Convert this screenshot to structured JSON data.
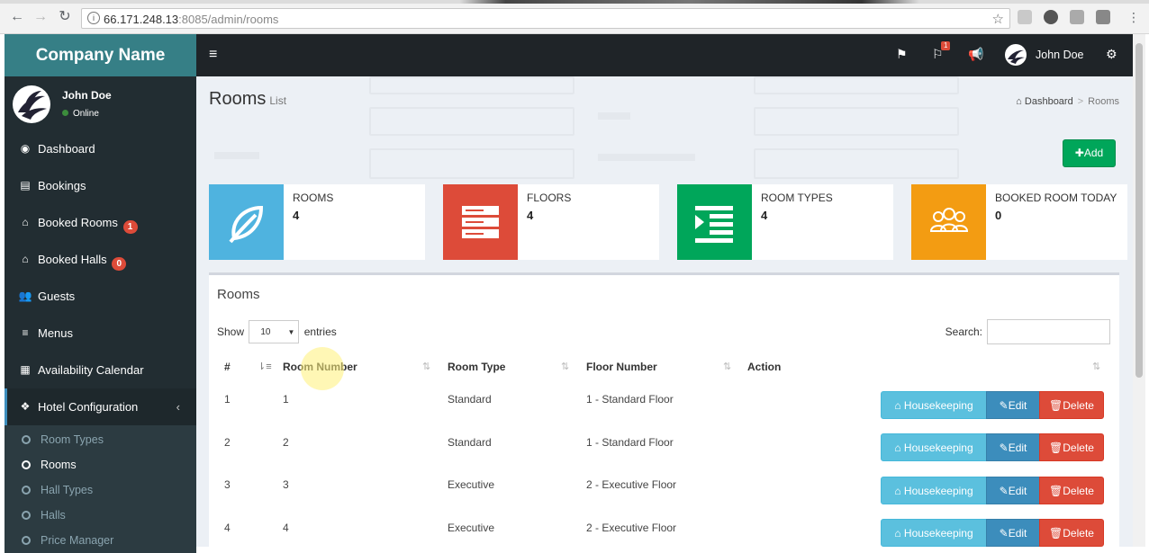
{
  "browser": {
    "url_host": "66.171.248.13",
    "url_rest": ":8085/admin/rooms"
  },
  "sidebar": {
    "brand": "Company Name",
    "user": {
      "name": "John Doe",
      "status": "Online"
    },
    "items": [
      {
        "label": "Dashboard",
        "icon": "dashboard-icon"
      },
      {
        "label": "Bookings",
        "icon": "list-icon"
      },
      {
        "label": "Booked Rooms",
        "icon": "home-icon",
        "badge": "1"
      },
      {
        "label": "Booked Halls",
        "icon": "home-icon",
        "badge": "0"
      },
      {
        "label": "Guests",
        "icon": "users-icon"
      },
      {
        "label": "Menus",
        "icon": "bars-icon"
      },
      {
        "label": "Availability Calendar",
        "icon": "calendar-icon"
      },
      {
        "label": "Hotel Configuration",
        "icon": "cubes-icon"
      }
    ],
    "submenu": [
      {
        "label": "Room Types"
      },
      {
        "label": "Rooms"
      },
      {
        "label": "Hall Types"
      },
      {
        "label": "Halls"
      },
      {
        "label": "Price Manager"
      }
    ]
  },
  "topnav": {
    "flag_badge": "1",
    "user_name": "John Doe"
  },
  "page": {
    "title": "Rooms",
    "subtitle": "List",
    "breadcrumb": [
      "Dashboard",
      "Rooms"
    ],
    "add_label": "Add"
  },
  "stats": [
    {
      "label": "ROOMS",
      "value": "4",
      "color": "#4fb3df",
      "icon": "leaf-icon"
    },
    {
      "label": "FLOORS",
      "value": "4",
      "color": "#dd4b39",
      "icon": "server-icon"
    },
    {
      "label": "ROOM TYPES",
      "value": "4",
      "color": "#00a65a",
      "icon": "indent-icon"
    },
    {
      "label": "BOOKED ROOM TODAY",
      "value": "0",
      "color": "#f39c12",
      "icon": "group-icon"
    }
  ],
  "table": {
    "title": "Rooms",
    "show_label": "Show",
    "length_value": "10",
    "entries_label": "entries",
    "search_label": "Search:",
    "columns": [
      "#",
      "Room Number",
      "Room Type",
      "Floor Number",
      "Action"
    ],
    "rows": [
      {
        "idx": "1",
        "number": "1",
        "type": "Standard",
        "floor": "1 - Standard Floor"
      },
      {
        "idx": "2",
        "number": "2",
        "type": "Standard",
        "floor": "1 - Standard Floor"
      },
      {
        "idx": "3",
        "number": "3",
        "type": "Executive",
        "floor": "2 - Executive Floor"
      },
      {
        "idx": "4",
        "number": "4",
        "type": "Executive",
        "floor": "2 - Executive Floor"
      }
    ],
    "actions": {
      "housekeeping": "Housekeeping",
      "edit": "Edit",
      "delete": "Delete"
    }
  }
}
